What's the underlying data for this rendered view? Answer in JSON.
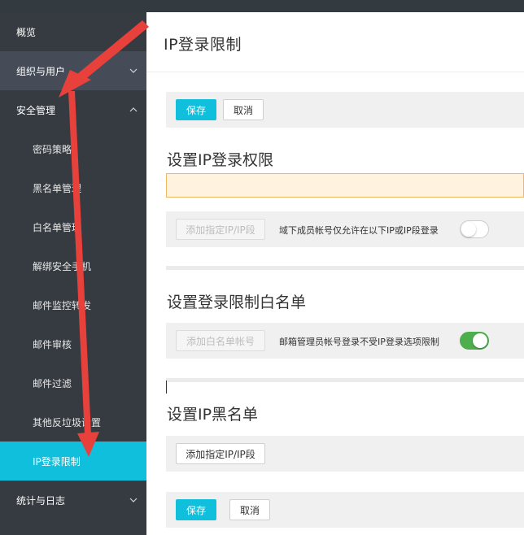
{
  "sidebar": {
    "items": [
      {
        "label": "概览"
      },
      {
        "label": "组织与用户"
      },
      {
        "label": "安全管理"
      },
      {
        "label": "密码策略"
      },
      {
        "label": "黑名单管理"
      },
      {
        "label": "白名单管理"
      },
      {
        "label": "解绑安全手机"
      },
      {
        "label": "邮件监控转发"
      },
      {
        "label": "邮件审核"
      },
      {
        "label": "邮件过滤"
      },
      {
        "label": "其他反垃圾设置"
      },
      {
        "label": "IP登录限制"
      },
      {
        "label": "统计与日志"
      }
    ]
  },
  "main": {
    "title": "IP登录限制",
    "toolbar_top": {
      "save": "保存",
      "cancel": "取消"
    },
    "section_ip_permission": {
      "title": "设置IP登录权限",
      "add_button": "添加指定IP/IP段",
      "option_label": "域下成员帐号仅允许在以下IP或IP段登录",
      "toggle_on": false
    },
    "section_whitelist": {
      "title": "设置登录限制白名单",
      "add_button": "添加白名单帐号",
      "option_label": "邮箱管理员帐号登录不受IP登录选项限制",
      "toggle_on": true
    },
    "section_blacklist": {
      "title": "设置IP黑名单",
      "add_button": "添加指定IP/IP段"
    },
    "toolbar_bottom": {
      "save": "保存",
      "cancel": "取消"
    }
  },
  "colors": {
    "sidebar_bg": "#353b41",
    "sidebar_group_bg": "#454c57",
    "active_bg": "#10bfdb",
    "primary_button": "#10bfdb",
    "toggle_on": "#4cae4c",
    "warning_bg": "#fff3e0",
    "warning_border": "#f0b860",
    "annotation_arrow": "#e8413c"
  }
}
